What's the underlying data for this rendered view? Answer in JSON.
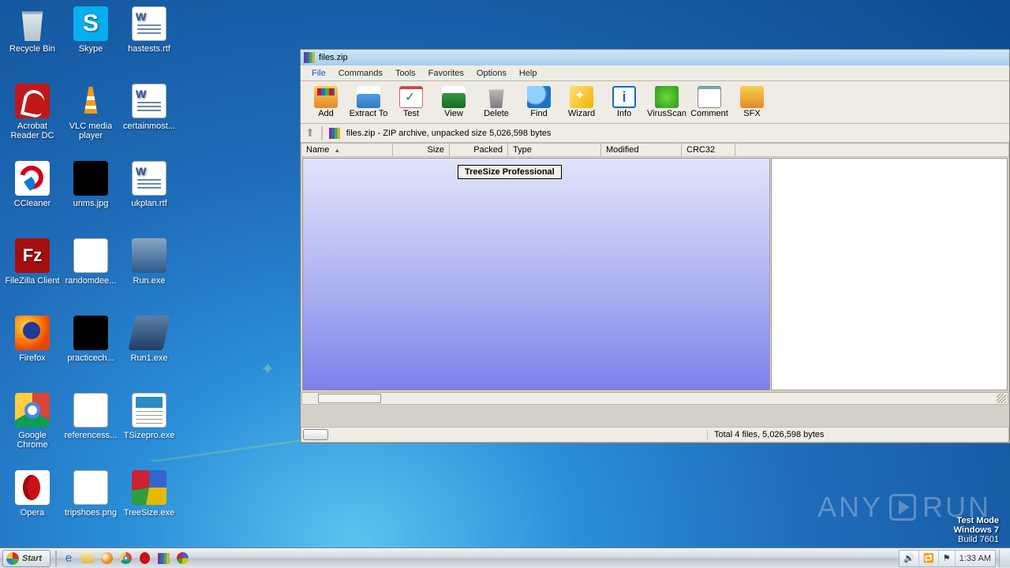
{
  "desktop": {
    "icons": [
      {
        "label": "Recycle Bin",
        "glyph": "g-bin"
      },
      {
        "label": "Skype",
        "glyph": "g-skype",
        "txt": "S"
      },
      {
        "label": "hastests.rtf",
        "glyph": "g-word"
      },
      {
        "label": "Acrobat Reader DC",
        "glyph": "g-acrobat"
      },
      {
        "label": "VLC media player",
        "glyph": "g-vlc"
      },
      {
        "label": "certainmost...",
        "glyph": "g-word"
      },
      {
        "label": "CCleaner",
        "glyph": "g-cc"
      },
      {
        "label": "unms.jpg",
        "glyph": "g-black"
      },
      {
        "label": "ukplan.rtf",
        "glyph": "g-word"
      },
      {
        "label": "FileZilla Client",
        "glyph": "g-filezilla",
        "txt": "Fz"
      },
      {
        "label": "randomdee...",
        "glyph": "g-white"
      },
      {
        "label": "Run.exe",
        "glyph": "g-runexe"
      },
      {
        "label": "Firefox",
        "glyph": "g-firefox"
      },
      {
        "label": "practicech...",
        "glyph": "g-black"
      },
      {
        "label": "Run1.exe",
        "glyph": "g-run1"
      },
      {
        "label": "Google Chrome",
        "glyph": "g-chrome"
      },
      {
        "label": "referencess...",
        "glyph": "g-white"
      },
      {
        "label": "TSizepro.exe",
        "glyph": "g-placeholder"
      },
      {
        "label": "Opera",
        "glyph": "g-opera"
      },
      {
        "label": "tripshoes.png",
        "glyph": "g-white"
      },
      {
        "label": "TreeSize.exe",
        "glyph": "g-tree"
      }
    ]
  },
  "window": {
    "title": "files.zip",
    "menu": [
      "File",
      "Commands",
      "Tools",
      "Favorites",
      "Options",
      "Help"
    ],
    "toolbar": [
      {
        "label": "Add",
        "icon": "ti-add"
      },
      {
        "label": "Extract To",
        "icon": "ti-extract"
      },
      {
        "label": "Test",
        "icon": "ti-test"
      },
      {
        "label": "View",
        "icon": "ti-view"
      },
      {
        "label": "Delete",
        "icon": "ti-delete"
      },
      {
        "label": "Find",
        "icon": "ti-find"
      },
      {
        "label": "Wizard",
        "icon": "ti-wizard"
      },
      {
        "label": "Info",
        "icon": "ti-info",
        "txt": "i"
      },
      {
        "label": "VirusScan",
        "icon": "ti-virus"
      },
      {
        "label": "Comment",
        "icon": "ti-comment"
      },
      {
        "label": "SFX",
        "icon": "ti-sfx"
      }
    ],
    "path": "files.zip - ZIP archive, unpacked size 5,026,598 bytes",
    "columns": {
      "name": "Name",
      "size": "Size",
      "packed": "Packed",
      "type": "Type",
      "modified": "Modified",
      "crc": "CRC32"
    },
    "splash": "TreeSize Professional",
    "status": "Total 4 files, 5,026,598 bytes"
  },
  "watermark": {
    "brand_a": "ANY",
    "brand_b": "RUN"
  },
  "build": {
    "l1": "Test Mode",
    "l2": "Windows 7",
    "l3": "Build 7601"
  },
  "taskbar": {
    "start": "Start",
    "tray": {
      "time": "1:33 AM",
      "flag": "⚑",
      "net": "🔁",
      "vol": "🔊"
    }
  }
}
